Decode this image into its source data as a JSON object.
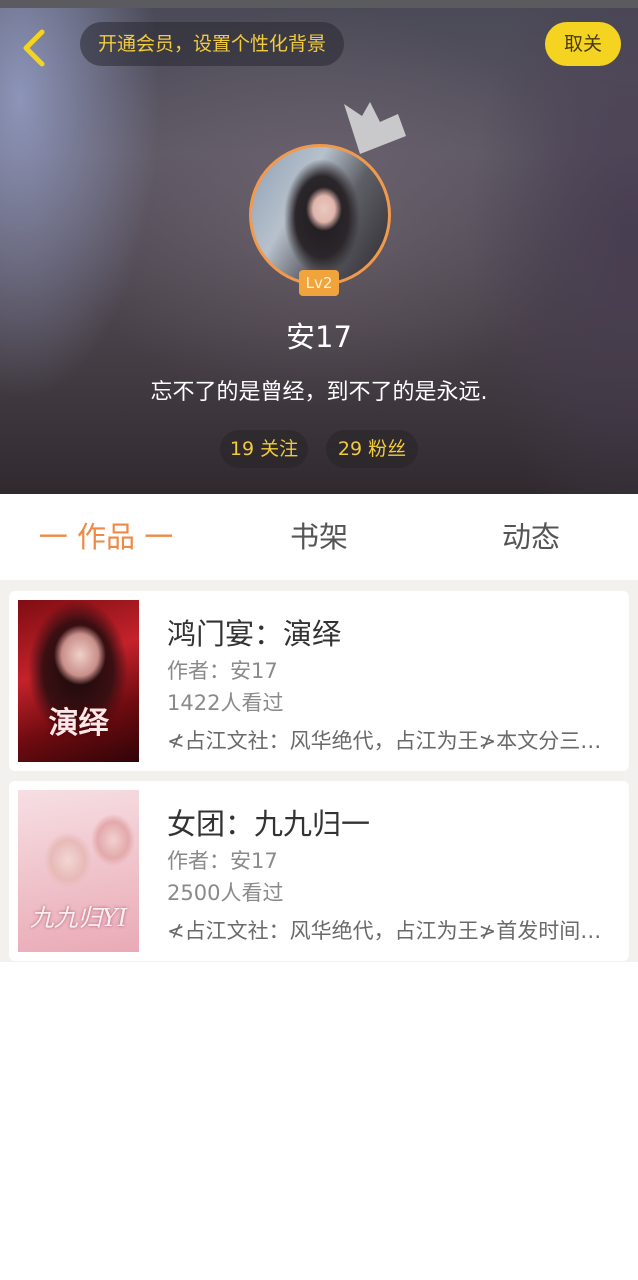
{
  "header": {
    "vip_prompt": "开通会员，设置个性化背景",
    "cancel_label": "取关",
    "level_badge": "Lv2",
    "username": "安17",
    "signature": "忘不了的是曾经，到不了的是永远.",
    "following": "19 关注",
    "fans": "29 粉丝"
  },
  "tabs": [
    {
      "label": "一 作品 一",
      "active": true
    },
    {
      "label": "书架",
      "active": false
    },
    {
      "label": "动态",
      "active": false
    }
  ],
  "works": [
    {
      "title": "鸿门宴：演绎",
      "author": "作者：安17",
      "views": "1422人看过",
      "description": "≮占江文社：风华绝代，占江为王≯本文分三…",
      "cover_text": "演绎"
    },
    {
      "title": "女团：九九归一",
      "author": "作者：安17",
      "views": "2500人看过",
      "description": "≮占江文社：风华绝代，占江为王≯首发时间…",
      "cover_text": "九九归YI"
    }
  ],
  "colors": {
    "accent_orange": "#ef8a46",
    "accent_yellow": "#f5d321",
    "stat_text": "#f0cb3d"
  }
}
